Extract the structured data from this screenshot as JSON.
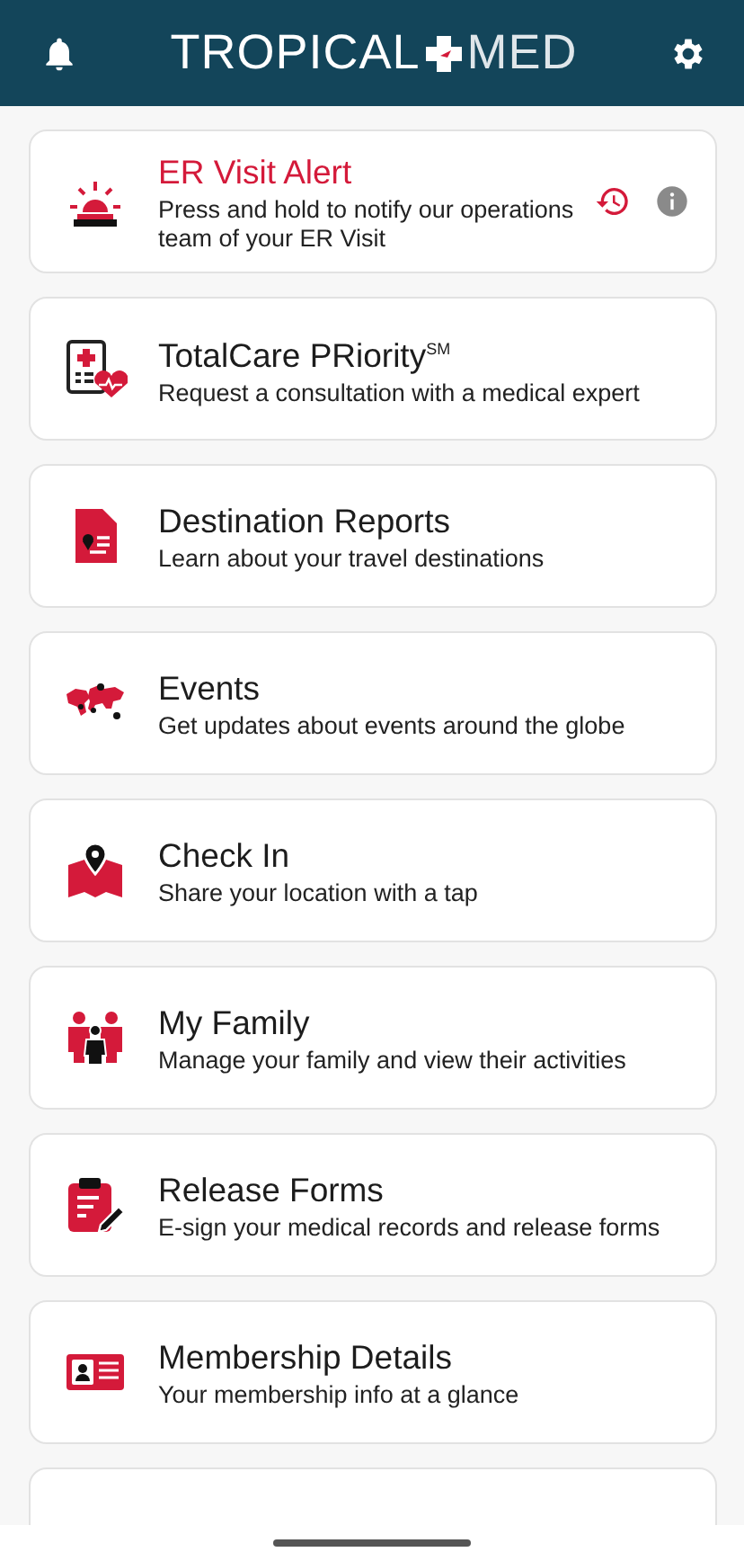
{
  "header": {
    "logo_left": "TROPICAL",
    "logo_right": "MED"
  },
  "cards": [
    {
      "kind": "alert",
      "title": "ER Visit Alert",
      "subtitle": "Press and hold to notify our operations team of your ER Visit"
    },
    {
      "kind": "totalcare",
      "title": "TotalCare PRiority$^{SM}$",
      "subtitle": "Request a consultation with a medical expert"
    },
    {
      "kind": "reports",
      "title": "Destination Reports",
      "subtitle": "Learn about your travel destinations"
    },
    {
      "kind": "events",
      "title": "Events",
      "subtitle": "Get updates about events around the globe"
    },
    {
      "kind": "checkin",
      "title": "Check In",
      "subtitle": "Share your location with a tap"
    },
    {
      "kind": "family",
      "title": "My Family",
      "subtitle": "Manage your family and view their activities"
    },
    {
      "kind": "forms",
      "title": "Release Forms",
      "subtitle": "E-sign your medical records and release forms"
    },
    {
      "kind": "membership",
      "title": "Membership Details",
      "subtitle": "Your membership info at a glance"
    },
    {
      "kind": "partial"
    }
  ]
}
